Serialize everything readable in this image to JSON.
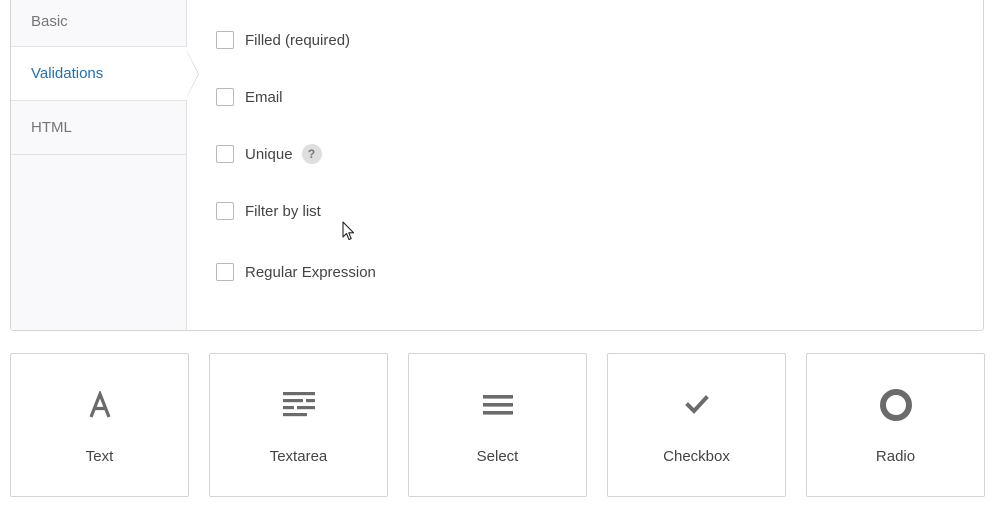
{
  "tabs": [
    {
      "label": "Basic",
      "active": false
    },
    {
      "label": "Validations",
      "active": true
    },
    {
      "label": "HTML",
      "active": false
    }
  ],
  "validations": {
    "filled": {
      "label": "Filled (required)",
      "checked": false
    },
    "email": {
      "label": "Email",
      "checked": false
    },
    "unique": {
      "label": "Unique",
      "checked": false,
      "help": "?"
    },
    "filter_by_list": {
      "label": "Filter by list",
      "checked": false
    },
    "regex": {
      "label": "Regular Expression",
      "checked": false
    }
  },
  "field_types": [
    {
      "label": "Text",
      "icon": "text-icon"
    },
    {
      "label": "Textarea",
      "icon": "textarea-icon"
    },
    {
      "label": "Select",
      "icon": "select-icon"
    },
    {
      "label": "Checkbox",
      "icon": "checkbox-icon"
    },
    {
      "label": "Radio",
      "icon": "radio-icon"
    }
  ],
  "colors": {
    "active_tab_text": "#2271b1",
    "sidebar_bg": "#f9f9fb",
    "icon": "#6b6b6b",
    "border": "#d4d4d4"
  }
}
